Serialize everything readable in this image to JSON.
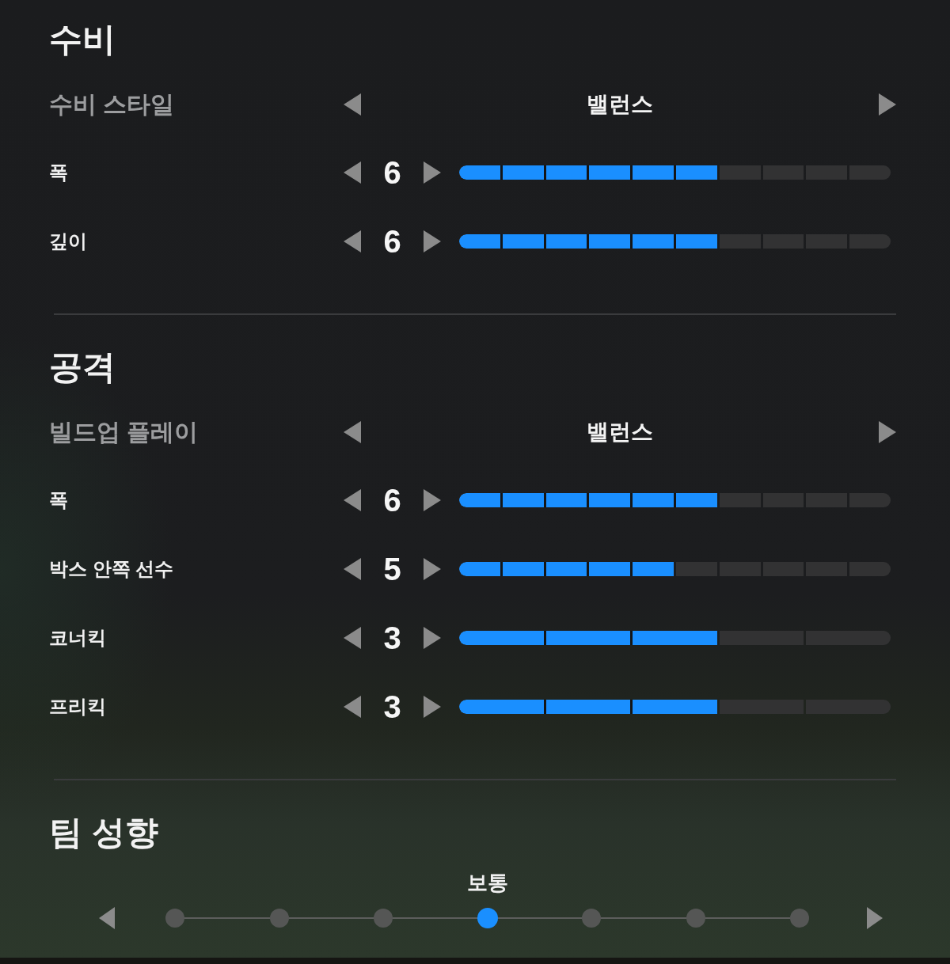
{
  "sections": [
    {
      "title": "수비",
      "selector": {
        "label": "수비 스타일",
        "value": "밸런스"
      },
      "sliders": [
        {
          "label": "폭",
          "value": "6",
          "level": 0.6,
          "kind": "fine"
        },
        {
          "label": "깊이",
          "value": "6",
          "level": 0.6,
          "kind": "fine"
        }
      ]
    },
    {
      "title": "공격",
      "selector": {
        "label": "빌드업 플레이",
        "value": "밸런스"
      },
      "sliders": [
        {
          "label": "폭",
          "value": "6",
          "level": 0.6,
          "kind": "fine"
        },
        {
          "label": "박스 안쪽 선수",
          "value": "5",
          "level": 0.5,
          "kind": "fine"
        },
        {
          "label": "코너킥",
          "value": "3",
          "level": 0.6,
          "kind": "coarse"
        },
        {
          "label": "프리킥",
          "value": "3",
          "level": 0.6,
          "kind": "coarse"
        }
      ]
    }
  ],
  "team_tendency": {
    "title": "팀 성향",
    "value": "보통",
    "steps": [
      {
        "selected": false
      },
      {
        "selected": false
      },
      {
        "selected": false
      },
      {
        "selected": true
      },
      {
        "selected": false
      },
      {
        "selected": false
      },
      {
        "selected": false
      }
    ]
  }
}
